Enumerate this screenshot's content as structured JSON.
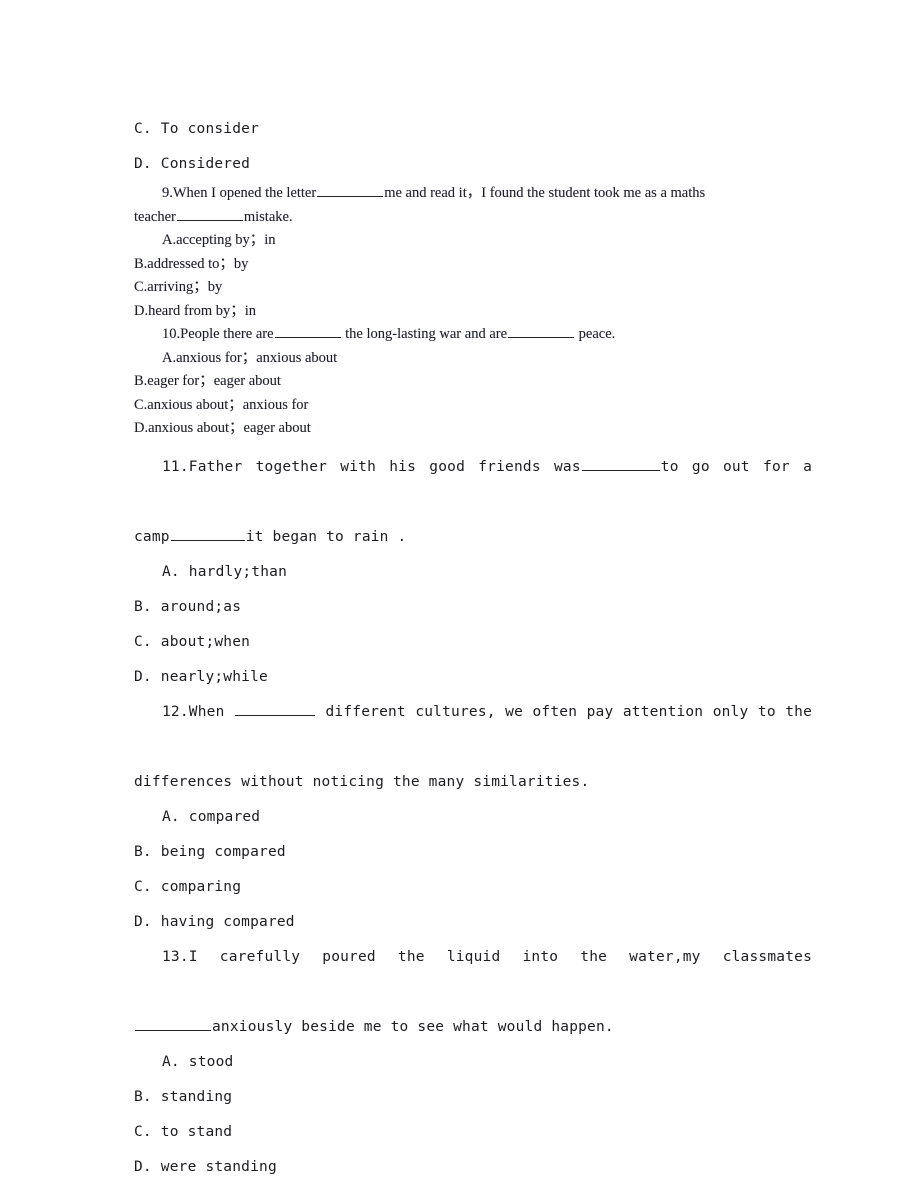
{
  "document": {
    "type": "english-grammar-worksheet",
    "page_background": "#ffffff",
    "text_color": "#1d1d21"
  },
  "leftover_options": {
    "option_c": "C. To consider",
    "option_d": "D. Considered"
  },
  "questions": [
    {
      "number": "9",
      "style": "serif",
      "stem_part_1": "9.When I opened the letter",
      "stem_part_2": "me and read it，I found the student took me as a maths",
      "stem_part_3": "teacher",
      "stem_part_4": "mistake.",
      "options": [
        "A.accepting by；in",
        "B.addressed to；by",
        "C.arriving；by",
        "D.heard from by；in"
      ]
    },
    {
      "number": "10",
      "style": "serif",
      "stem_part_1": "10.People there are",
      "stem_part_2": "the long-lasting war and are",
      "stem_part_3": "peace.",
      "options": [
        "A.anxious for；anxious about",
        "B.eager for；eager about",
        "C.anxious about；anxious for",
        "D.anxious about；eager about"
      ]
    },
    {
      "number": "11",
      "style": "mono",
      "stem_part_1": "11.Father together with his good friends was",
      "stem_part_2": "to go out for a",
      "stem_part_3": "camp",
      "stem_part_4": "it began to rain .",
      "options": [
        "A. hardly;than",
        "B. around;as",
        "C. about;when",
        "D. nearly;while"
      ]
    },
    {
      "number": "12",
      "style": "mono",
      "stem_part_1": "12.When",
      "stem_part_2": "different cultures, we often pay attention only to the",
      "stem_part_3": "differences without noticing the many similarities.",
      "options": [
        "A. compared",
        "B. being compared",
        "C. comparing",
        "D. having compared"
      ]
    },
    {
      "number": "13",
      "style": "mono",
      "stem_part_1": "13.I carefully poured the liquid into the water,my classmates",
      "stem_part_2": "anxiously beside me to see what would happen.",
      "options": [
        "A. stood",
        "B. standing",
        "C. to stand",
        "D. were standing"
      ]
    }
  ]
}
